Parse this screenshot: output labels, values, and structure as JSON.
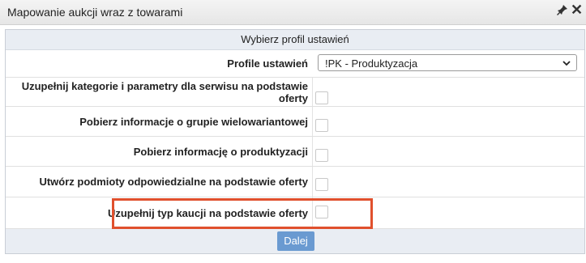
{
  "dialog": {
    "title": "Mapowanie aukcji wraz z towarami",
    "pin_icon": "pin-icon",
    "close_icon": "close-icon"
  },
  "form": {
    "section_header": "Wybierz profil ustawień",
    "profile_label": "Profile ustawień",
    "profile_value": "!PK - Produktyzacja",
    "options": [
      {
        "label": "Uzupełnij kategorie i parametry dla serwisu na podstawie oferty",
        "checked": false
      },
      {
        "label": "Pobierz informacje o grupie wielowariantowej",
        "checked": false
      },
      {
        "label": "Pobierz informację o produktyzacji",
        "checked": false
      },
      {
        "label": "Utwórz podmioty odpowiedzialne na podstawie oferty",
        "checked": false
      },
      {
        "label": "Uzupełnij typ kaucji na podstawie oferty",
        "checked": false
      }
    ],
    "submit_label": "Dalej"
  },
  "colors": {
    "highlight": "#e0502d",
    "button": "#6a9ad1",
    "header_bg": "#e9edf3"
  }
}
